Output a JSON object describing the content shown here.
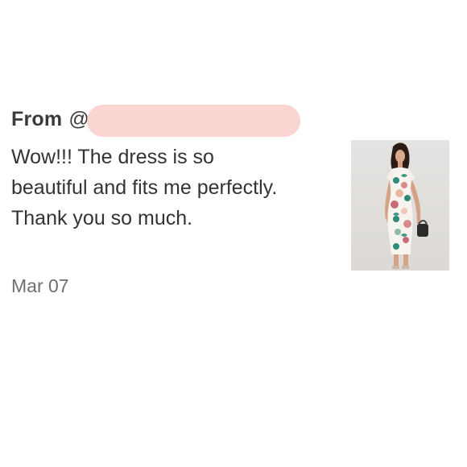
{
  "review": {
    "from_label": "From",
    "from_at": "@",
    "text": "Wow!!! The dress is so beautiful and fits me perfectly. Thank you so much.",
    "date": "Mar 07"
  },
  "colors": {
    "redaction": "#fbd5d2",
    "text": "#333333",
    "date": "#6f6f6f"
  },
  "product_image": {
    "icon": "floral-dress-photo"
  }
}
